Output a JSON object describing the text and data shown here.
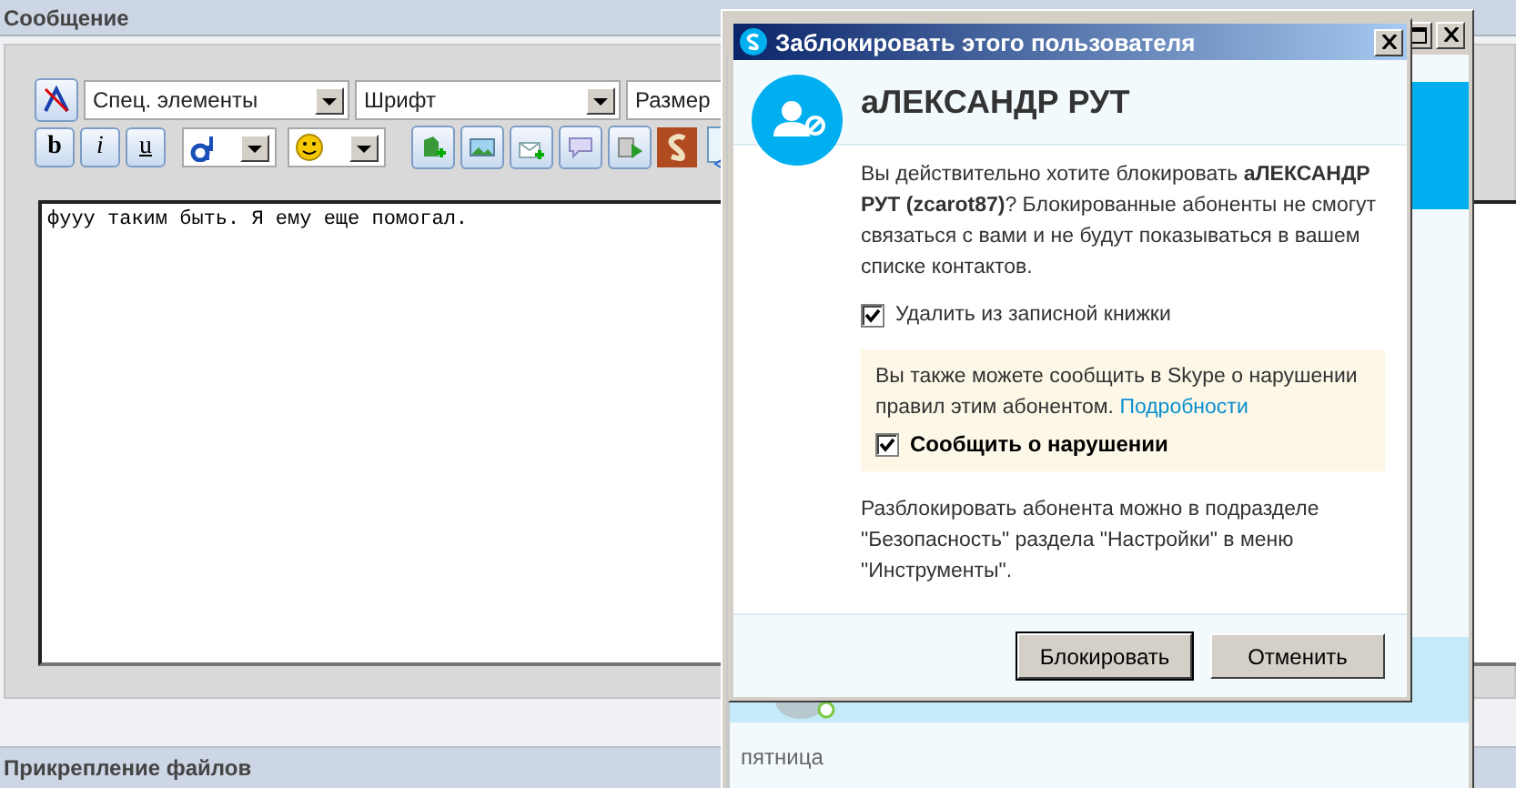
{
  "forum": {
    "section_title": "Сообщение",
    "selects": [
      "Спец. элементы",
      "Шрифт",
      "Размер"
    ],
    "format_buttons": [
      {
        "label": "b",
        "kind": "bold"
      },
      {
        "label": "i",
        "kind": "italic"
      },
      {
        "label": "u",
        "kind": "underline"
      }
    ],
    "message_text": "фууу таким быть. Я ему еще помогал.",
    "attachments_title": "Прикрепление файлов"
  },
  "skype_window": {
    "day_label": "пятница"
  },
  "dialog": {
    "title": "Заблокировать этого пользователя",
    "contact_name": "аЛЕКСАНДР РУТ",
    "message": "Вы действительно хотите блокировать **аЛЕКСАНДР РУТ (zcarot87)**? Блокированные абоненты не смогут связаться с вами и не будут показываться в вашем списке контактов.",
    "remove_contact": {
      "label": "Удалить из записной книжки",
      "checked": true
    },
    "report_box": {
      "text": "Вы также можете сообщить в Skype о нарушении правил этим абонентом.",
      "link": "Подробности",
      "report": {
        "label": "Сообщить о нарушении",
        "checked": true
      }
    },
    "footer_note": "Разблокировать абонента можно в подразделе \"Безопасность\" раздела \"Настройки\" в меню \"Инструменты\".",
    "buttons": [
      {
        "label": "Блокировать",
        "default": true
      },
      {
        "label": "Отменить",
        "default": false
      }
    ]
  }
}
